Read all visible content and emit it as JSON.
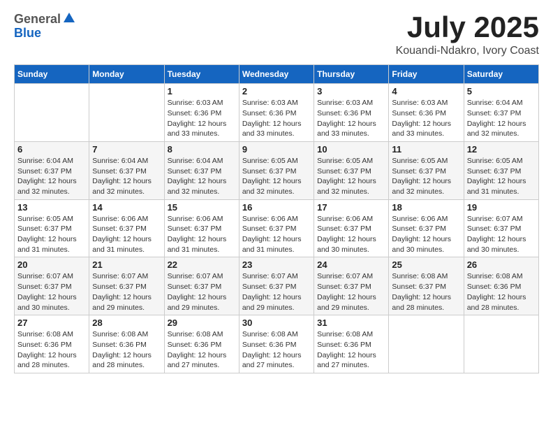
{
  "header": {
    "logo_general": "General",
    "logo_blue": "Blue",
    "title": "July 2025",
    "location": "Kouandi-Ndakro, Ivory Coast"
  },
  "weekdays": [
    "Sunday",
    "Monday",
    "Tuesday",
    "Wednesday",
    "Thursday",
    "Friday",
    "Saturday"
  ],
  "weeks": [
    [
      {
        "day": "",
        "sunrise": "",
        "sunset": "",
        "daylight": ""
      },
      {
        "day": "",
        "sunrise": "",
        "sunset": "",
        "daylight": ""
      },
      {
        "day": "1",
        "sunrise": "Sunrise: 6:03 AM",
        "sunset": "Sunset: 6:36 PM",
        "daylight": "Daylight: 12 hours and 33 minutes."
      },
      {
        "day": "2",
        "sunrise": "Sunrise: 6:03 AM",
        "sunset": "Sunset: 6:36 PM",
        "daylight": "Daylight: 12 hours and 33 minutes."
      },
      {
        "day": "3",
        "sunrise": "Sunrise: 6:03 AM",
        "sunset": "Sunset: 6:36 PM",
        "daylight": "Daylight: 12 hours and 33 minutes."
      },
      {
        "day": "4",
        "sunrise": "Sunrise: 6:03 AM",
        "sunset": "Sunset: 6:36 PM",
        "daylight": "Daylight: 12 hours and 33 minutes."
      },
      {
        "day": "5",
        "sunrise": "Sunrise: 6:04 AM",
        "sunset": "Sunset: 6:37 PM",
        "daylight": "Daylight: 12 hours and 32 minutes."
      }
    ],
    [
      {
        "day": "6",
        "sunrise": "Sunrise: 6:04 AM",
        "sunset": "Sunset: 6:37 PM",
        "daylight": "Daylight: 12 hours and 32 minutes."
      },
      {
        "day": "7",
        "sunrise": "Sunrise: 6:04 AM",
        "sunset": "Sunset: 6:37 PM",
        "daylight": "Daylight: 12 hours and 32 minutes."
      },
      {
        "day": "8",
        "sunrise": "Sunrise: 6:04 AM",
        "sunset": "Sunset: 6:37 PM",
        "daylight": "Daylight: 12 hours and 32 minutes."
      },
      {
        "day": "9",
        "sunrise": "Sunrise: 6:05 AM",
        "sunset": "Sunset: 6:37 PM",
        "daylight": "Daylight: 12 hours and 32 minutes."
      },
      {
        "day": "10",
        "sunrise": "Sunrise: 6:05 AM",
        "sunset": "Sunset: 6:37 PM",
        "daylight": "Daylight: 12 hours and 32 minutes."
      },
      {
        "day": "11",
        "sunrise": "Sunrise: 6:05 AM",
        "sunset": "Sunset: 6:37 PM",
        "daylight": "Daylight: 12 hours and 32 minutes."
      },
      {
        "day": "12",
        "sunrise": "Sunrise: 6:05 AM",
        "sunset": "Sunset: 6:37 PM",
        "daylight": "Daylight: 12 hours and 31 minutes."
      }
    ],
    [
      {
        "day": "13",
        "sunrise": "Sunrise: 6:05 AM",
        "sunset": "Sunset: 6:37 PM",
        "daylight": "Daylight: 12 hours and 31 minutes."
      },
      {
        "day": "14",
        "sunrise": "Sunrise: 6:06 AM",
        "sunset": "Sunset: 6:37 PM",
        "daylight": "Daylight: 12 hours and 31 minutes."
      },
      {
        "day": "15",
        "sunrise": "Sunrise: 6:06 AM",
        "sunset": "Sunset: 6:37 PM",
        "daylight": "Daylight: 12 hours and 31 minutes."
      },
      {
        "day": "16",
        "sunrise": "Sunrise: 6:06 AM",
        "sunset": "Sunset: 6:37 PM",
        "daylight": "Daylight: 12 hours and 31 minutes."
      },
      {
        "day": "17",
        "sunrise": "Sunrise: 6:06 AM",
        "sunset": "Sunset: 6:37 PM",
        "daylight": "Daylight: 12 hours and 30 minutes."
      },
      {
        "day": "18",
        "sunrise": "Sunrise: 6:06 AM",
        "sunset": "Sunset: 6:37 PM",
        "daylight": "Daylight: 12 hours and 30 minutes."
      },
      {
        "day": "19",
        "sunrise": "Sunrise: 6:07 AM",
        "sunset": "Sunset: 6:37 PM",
        "daylight": "Daylight: 12 hours and 30 minutes."
      }
    ],
    [
      {
        "day": "20",
        "sunrise": "Sunrise: 6:07 AM",
        "sunset": "Sunset: 6:37 PM",
        "daylight": "Daylight: 12 hours and 30 minutes."
      },
      {
        "day": "21",
        "sunrise": "Sunrise: 6:07 AM",
        "sunset": "Sunset: 6:37 PM",
        "daylight": "Daylight: 12 hours and 29 minutes."
      },
      {
        "day": "22",
        "sunrise": "Sunrise: 6:07 AM",
        "sunset": "Sunset: 6:37 PM",
        "daylight": "Daylight: 12 hours and 29 minutes."
      },
      {
        "day": "23",
        "sunrise": "Sunrise: 6:07 AM",
        "sunset": "Sunset: 6:37 PM",
        "daylight": "Daylight: 12 hours and 29 minutes."
      },
      {
        "day": "24",
        "sunrise": "Sunrise: 6:07 AM",
        "sunset": "Sunset: 6:37 PM",
        "daylight": "Daylight: 12 hours and 29 minutes."
      },
      {
        "day": "25",
        "sunrise": "Sunrise: 6:08 AM",
        "sunset": "Sunset: 6:37 PM",
        "daylight": "Daylight: 12 hours and 28 minutes."
      },
      {
        "day": "26",
        "sunrise": "Sunrise: 6:08 AM",
        "sunset": "Sunset: 6:36 PM",
        "daylight": "Daylight: 12 hours and 28 minutes."
      }
    ],
    [
      {
        "day": "27",
        "sunrise": "Sunrise: 6:08 AM",
        "sunset": "Sunset: 6:36 PM",
        "daylight": "Daylight: 12 hours and 28 minutes."
      },
      {
        "day": "28",
        "sunrise": "Sunrise: 6:08 AM",
        "sunset": "Sunset: 6:36 PM",
        "daylight": "Daylight: 12 hours and 28 minutes."
      },
      {
        "day": "29",
        "sunrise": "Sunrise: 6:08 AM",
        "sunset": "Sunset: 6:36 PM",
        "daylight": "Daylight: 12 hours and 27 minutes."
      },
      {
        "day": "30",
        "sunrise": "Sunrise: 6:08 AM",
        "sunset": "Sunset: 6:36 PM",
        "daylight": "Daylight: 12 hours and 27 minutes."
      },
      {
        "day": "31",
        "sunrise": "Sunrise: 6:08 AM",
        "sunset": "Sunset: 6:36 PM",
        "daylight": "Daylight: 12 hours and 27 minutes."
      },
      {
        "day": "",
        "sunrise": "",
        "sunset": "",
        "daylight": ""
      },
      {
        "day": "",
        "sunrise": "",
        "sunset": "",
        "daylight": ""
      }
    ]
  ]
}
